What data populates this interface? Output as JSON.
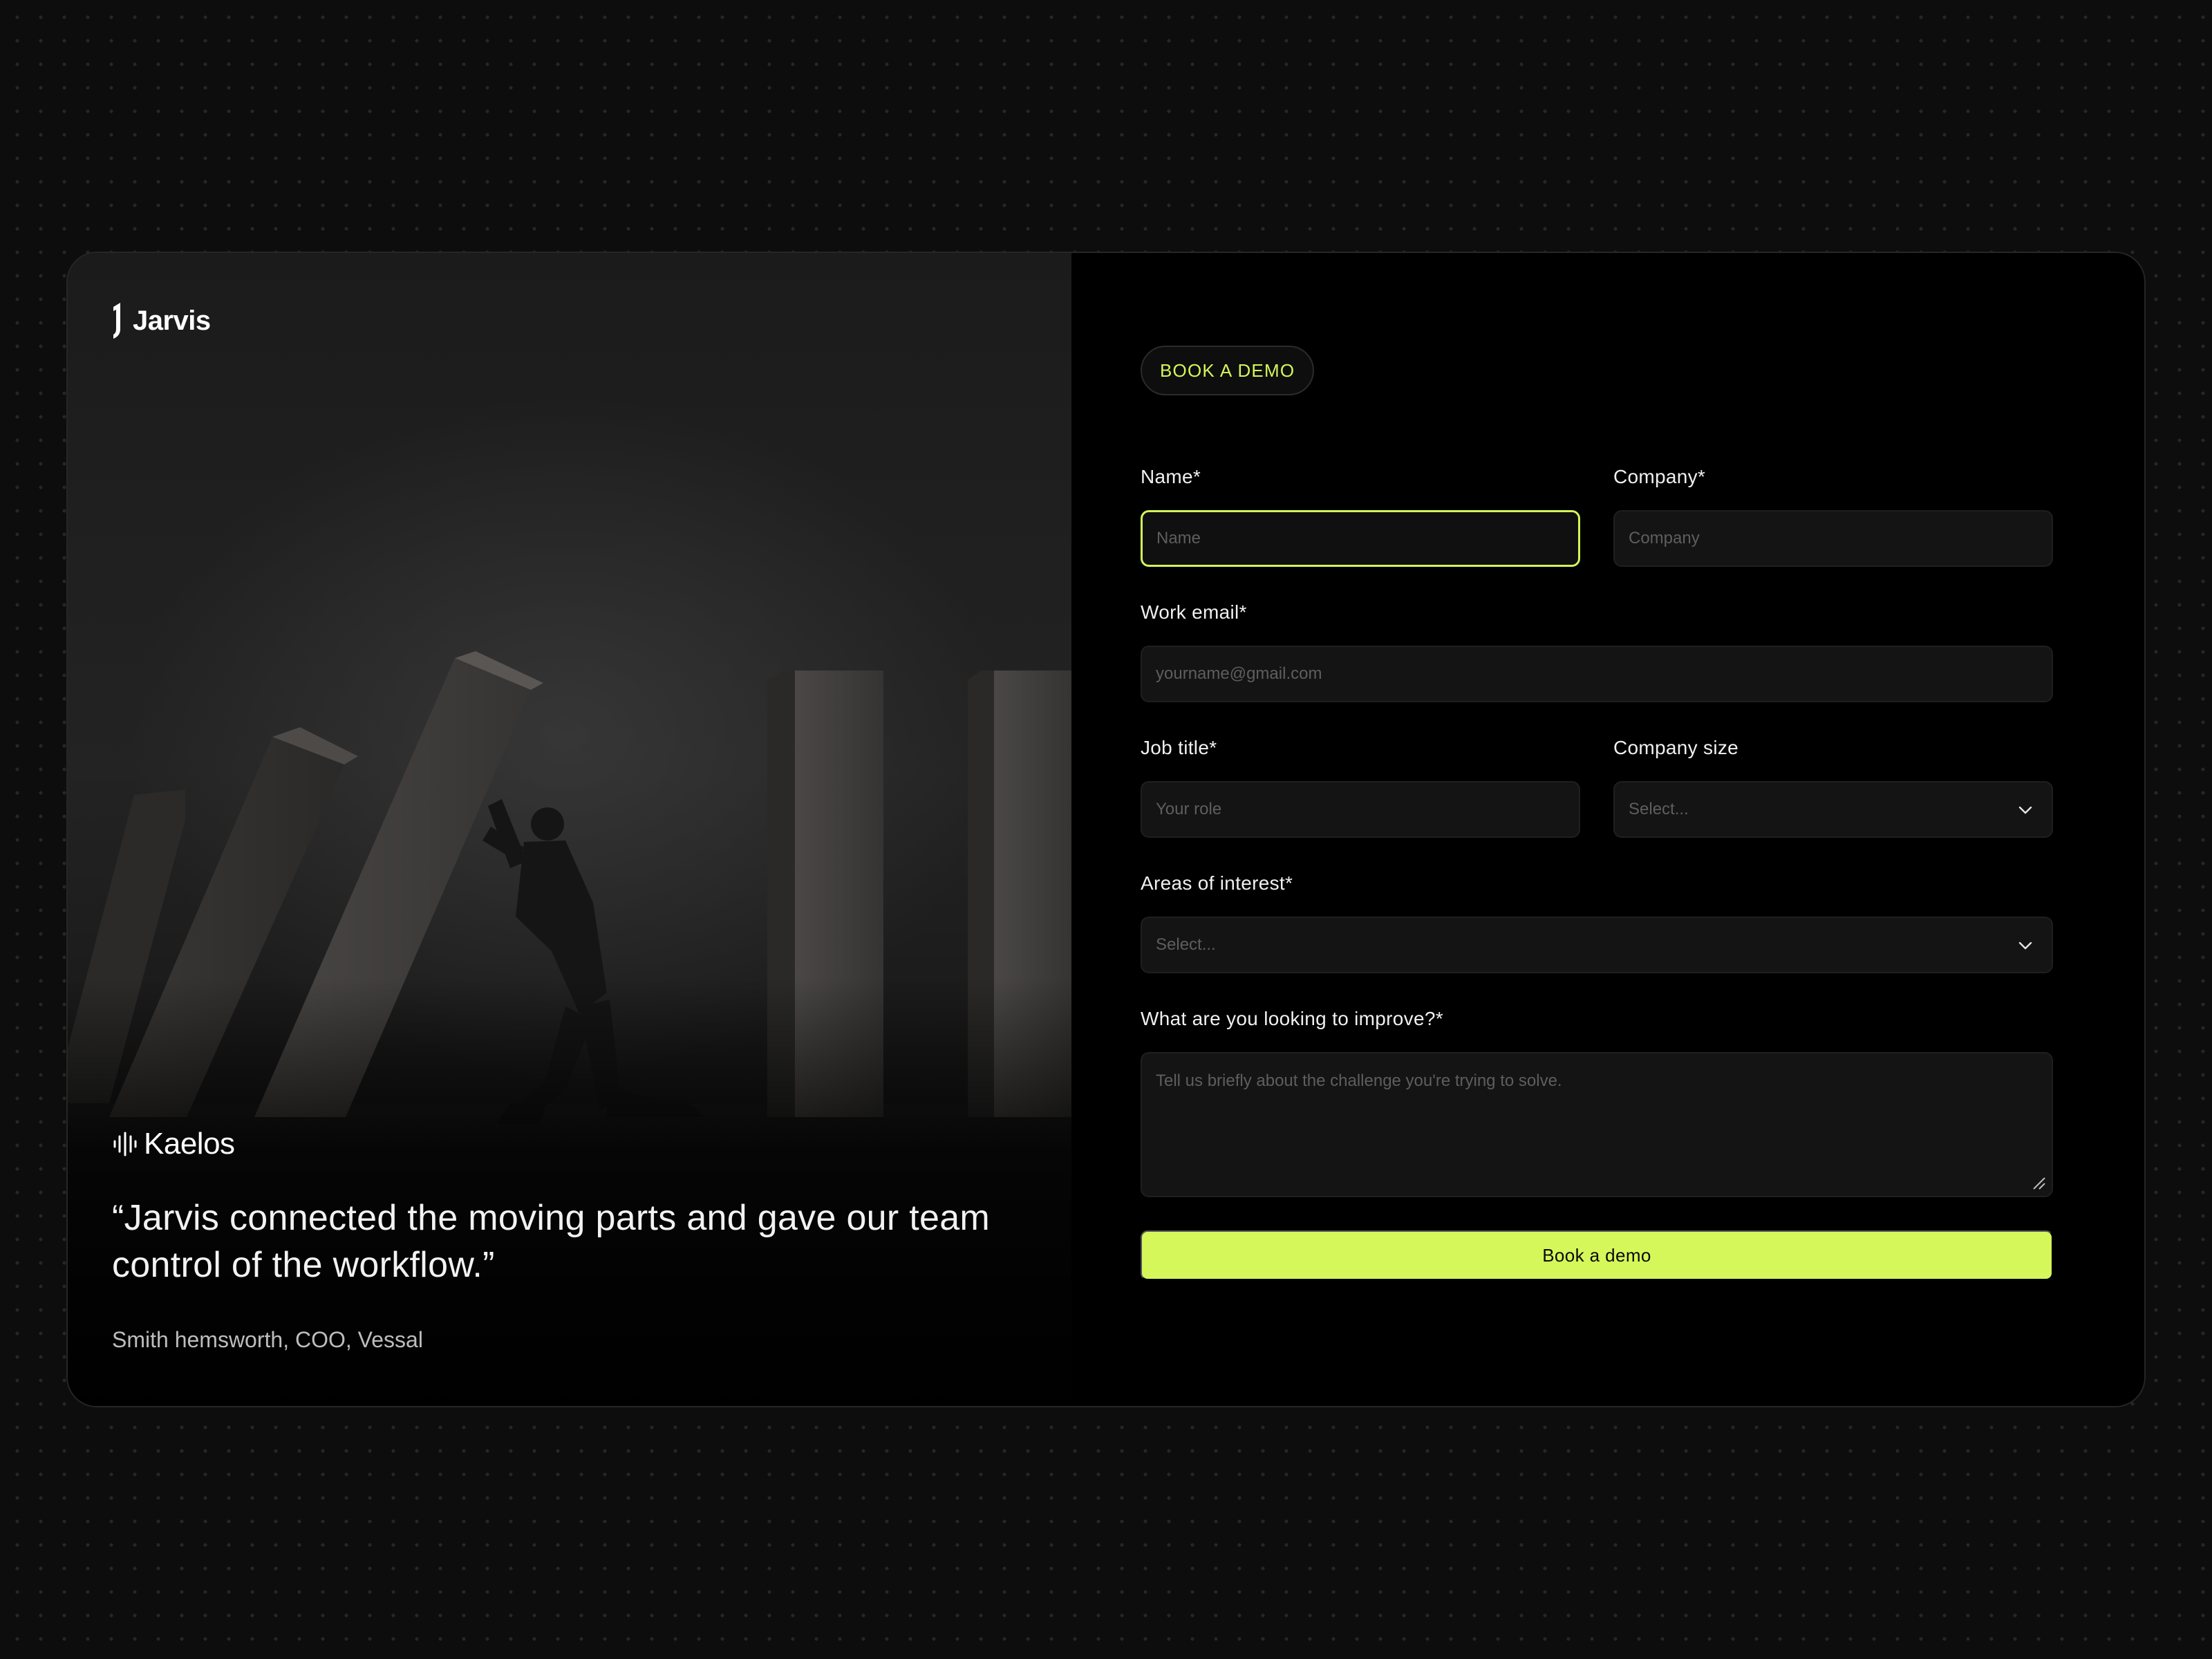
{
  "brand": {
    "name": "Jarvis",
    "logo_icon": "jarvis-logo-icon"
  },
  "testimonial": {
    "company": "Kaelos",
    "company_icon": "kaelos-waveform-icon",
    "quote": "“Jarvis connected the moving parts and gave our team control of the workflow.”",
    "author": "Smith hemsworth, COO, Vessal"
  },
  "form": {
    "badge": "BOOK A DEMO",
    "fields": {
      "name": {
        "label": "Name*",
        "placeholder": "Name",
        "value": ""
      },
      "company": {
        "label": "Company*",
        "placeholder": "Company",
        "value": ""
      },
      "work_email": {
        "label": "Work email*",
        "placeholder": "yourname@gmail.com",
        "value": ""
      },
      "job_title": {
        "label": "Job title*",
        "placeholder": "Your role",
        "value": ""
      },
      "company_size": {
        "label": "Company size",
        "selected": "Select...",
        "icon": "chevron-down-icon"
      },
      "areas_of_interest": {
        "label": "Areas of interest*",
        "selected": "Select...",
        "icon": "chevron-down-icon"
      },
      "improve": {
        "label": "What are you looking to improve?*",
        "placeholder": "Tell us briefly about the challenge you're trying to solve.",
        "value": ""
      }
    },
    "submit_label": "Book a demo"
  },
  "colors": {
    "accent": "#d6f75a",
    "background": "#000000",
    "field_bg": "#141414",
    "page_bg": "#0d0d0d"
  }
}
